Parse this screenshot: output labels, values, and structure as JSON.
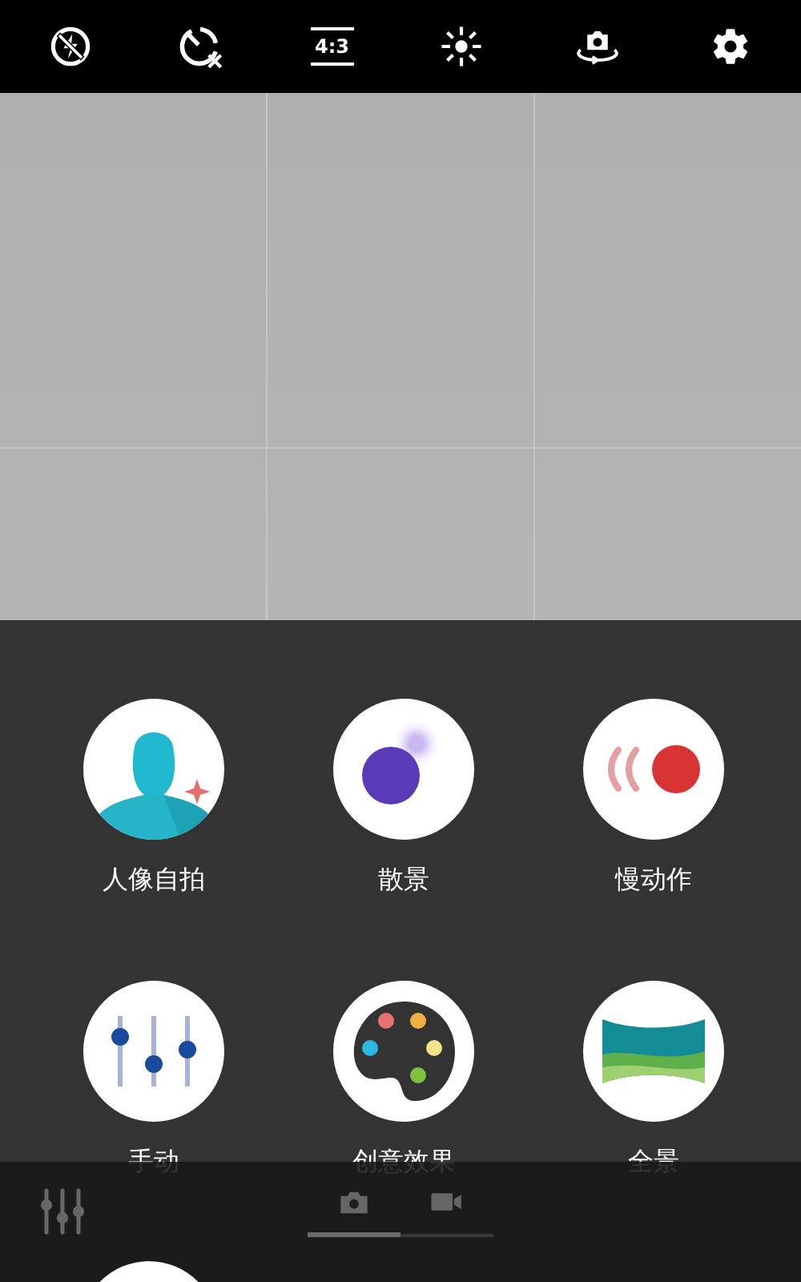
{
  "top_bar": {
    "aspect_ratio": "4:3"
  },
  "modes": [
    {
      "label": "人像自拍",
      "kind": "portrait"
    },
    {
      "label": "散景",
      "kind": "bokeh"
    },
    {
      "label": "慢动作",
      "kind": "slowmo"
    },
    {
      "label": "手动",
      "kind": "manual"
    },
    {
      "label": "创意效果",
      "kind": "creative"
    },
    {
      "label": "全景",
      "kind": "panorama"
    }
  ],
  "capture_tabs": [
    {
      "kind": "photo",
      "selected": true
    },
    {
      "kind": "video",
      "selected": false
    }
  ]
}
